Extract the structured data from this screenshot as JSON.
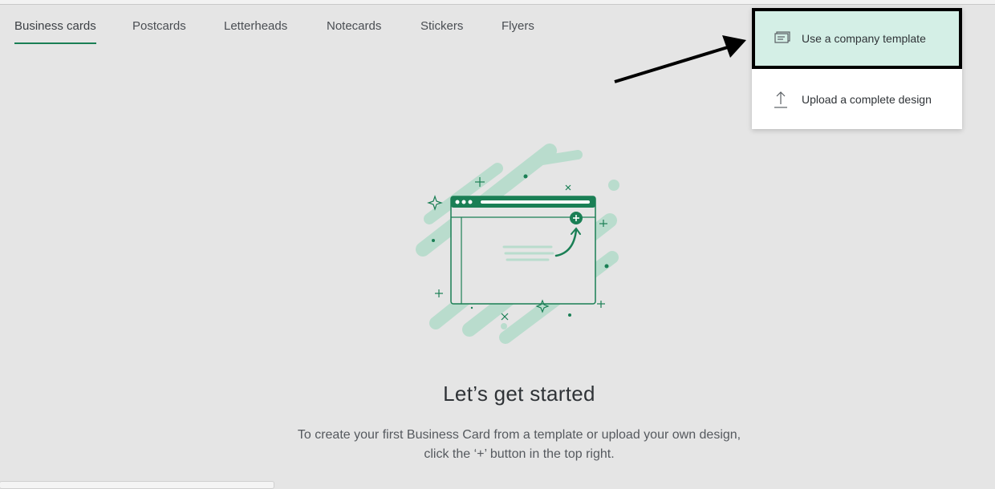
{
  "tabs": [
    {
      "label": "Business cards",
      "active": true
    },
    {
      "label": "Postcards",
      "active": false
    },
    {
      "label": "Letterheads",
      "active": false
    },
    {
      "label": "Notecards",
      "active": false
    },
    {
      "label": "Stickers",
      "active": false
    },
    {
      "label": "Flyers",
      "active": false
    }
  ],
  "menu": {
    "items": [
      {
        "label": "Use a company template",
        "icon": "template-icon",
        "highlighted": true
      },
      {
        "label": "Upload a complete design",
        "icon": "upload-icon",
        "highlighted": false
      }
    ]
  },
  "empty_state": {
    "heading": "Let’s get started",
    "line1": "To create your first Business Card from a template or upload your own design,",
    "line2": "click the ‘+’ button in the top right."
  },
  "colors": {
    "accent": "#1a7f55",
    "highlight": "#d4efe6",
    "illustration_light": "#b9dccd",
    "background": "#e5e5e5"
  }
}
